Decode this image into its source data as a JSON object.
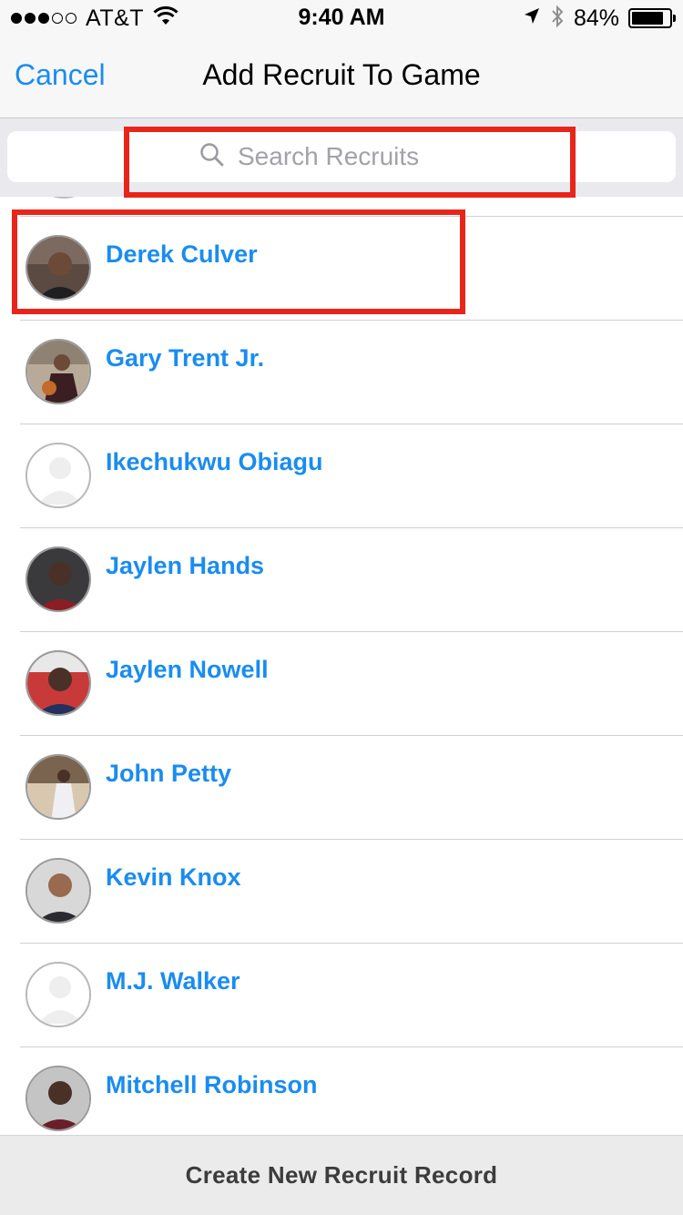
{
  "status_bar": {
    "carrier": "AT&T",
    "signal_icon": "signal-dots-icon",
    "wifi_icon": "wifi-icon",
    "time": "9:40 AM",
    "location_icon": "location-arrow-icon",
    "bluetooth_icon": "bluetooth-icon",
    "battery_percent": "84%",
    "battery_level": 0.84
  },
  "nav": {
    "cancel_label": "Cancel",
    "title": "Add Recruit To Game"
  },
  "search": {
    "placeholder": "Search Recruits",
    "value": "",
    "icon": "search-icon"
  },
  "recruits": [
    {
      "name": "Derek Culver",
      "avatar": "photo"
    },
    {
      "name": "Gary Trent Jr.",
      "avatar": "photo"
    },
    {
      "name": "Ikechukwu Obiagu",
      "avatar": "placeholder"
    },
    {
      "name": "Jaylen Hands",
      "avatar": "photo"
    },
    {
      "name": "Jaylen Nowell",
      "avatar": "photo"
    },
    {
      "name": "John Petty",
      "avatar": "photo"
    },
    {
      "name": "Kevin Knox",
      "avatar": "photo"
    },
    {
      "name": "M.J. Walker",
      "avatar": "placeholder"
    },
    {
      "name": "Mitchell Robinson",
      "avatar": "photo"
    }
  ],
  "bottom": {
    "create_label": "Create New Recruit Record"
  },
  "colors": {
    "accent": "#1a8cf0",
    "highlight": "#e8251b",
    "bar_background": "#f7f7f7"
  }
}
